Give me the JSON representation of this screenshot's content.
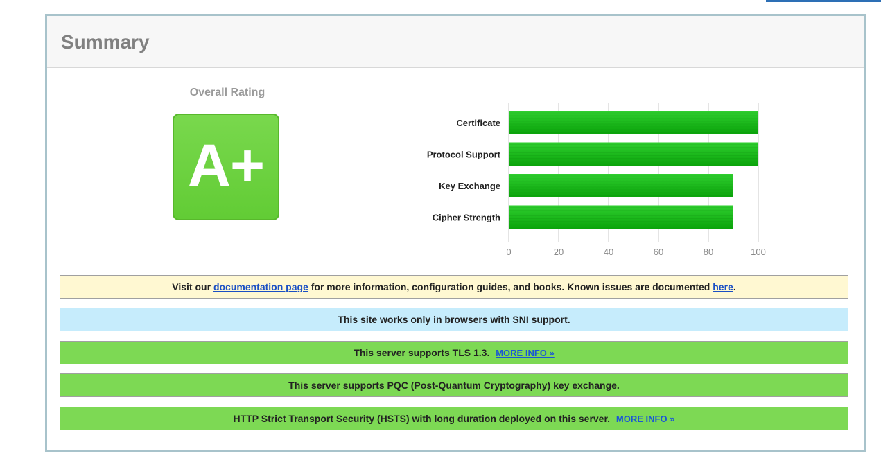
{
  "summary": {
    "title": "Summary",
    "overall_rating_label": "Overall Rating",
    "grade": "A+"
  },
  "chart_data": {
    "type": "bar",
    "orientation": "horizontal",
    "categories": [
      "Certificate",
      "Protocol Support",
      "Key Exchange",
      "Cipher Strength"
    ],
    "values": [
      100,
      100,
      90,
      90
    ],
    "xlim": [
      0,
      100
    ],
    "ticks": [
      0,
      20,
      40,
      60,
      80,
      100
    ],
    "grid": true,
    "colors": {
      "bar": "#1bbf1b",
      "bar_dark": "#0aa30a",
      "grid": "#c8c8c8",
      "tick": "#888888"
    }
  },
  "notices": {
    "documentation": {
      "prefix": "Visit our ",
      "link1": "documentation page",
      "middle": " for more information, configuration guides, and books. Known issues are documented ",
      "link2": "here",
      "suffix": "."
    },
    "sni": {
      "text": "This site works only in browsers with SNI support."
    },
    "tls13": {
      "text": "This server supports TLS 1.3.",
      "more": "MORE INFO »"
    },
    "pqc": {
      "text": "This server supports PQC (Post-Quantum Cryptography) key exchange."
    },
    "hsts": {
      "text": "HTTP Strict Transport Security (HSTS) with long duration deployed on this server.",
      "more": "MORE INFO »"
    }
  },
  "colors": {
    "notice_yellow": "#fff8d2",
    "notice_blue": "#c6ecfc",
    "notice_green": "#7dd954",
    "grade_green": "#68cf3a",
    "link": "#1a4fc4"
  }
}
